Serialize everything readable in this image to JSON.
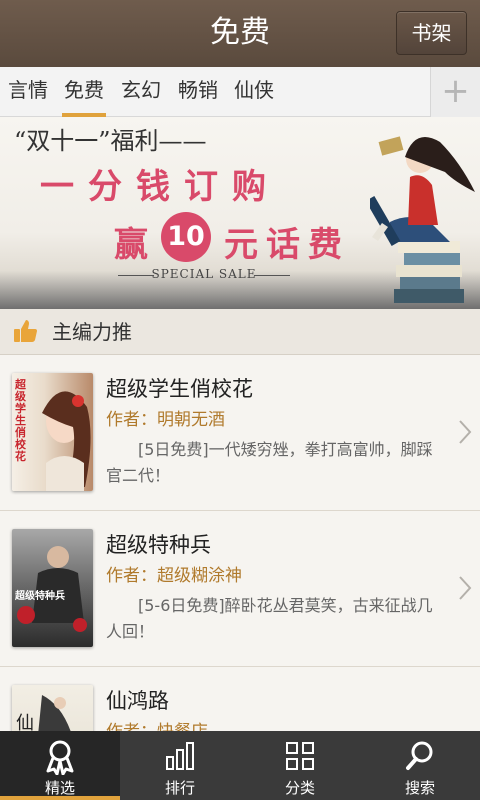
{
  "header": {
    "title": "免费",
    "shelf_button": "书架"
  },
  "tabs": [
    {
      "label": "言情",
      "active": false
    },
    {
      "label": "免费",
      "active": true
    },
    {
      "label": "玄幻",
      "active": false
    },
    {
      "label": "畅销",
      "active": false
    },
    {
      "label": "仙侠",
      "active": false
    }
  ],
  "tab_add_icon": "plus-icon",
  "banner": {
    "line1": "“双十一”福利——",
    "line2": "一分钱订购",
    "line3_prefix": "赢",
    "line3_number": "10",
    "line3_suffix": "元话费",
    "tag": "SPECIAL SALE"
  },
  "section": {
    "title": "主编力推",
    "icon": "thumbs-up-icon"
  },
  "books": [
    {
      "title": "超级学生俏校花",
      "author": "作者：明朝无酒",
      "desc": "[5日免费]一代矮穷矬，拳打高富帅，脚踩官二代！",
      "cover_text": "超级学生俏校花"
    },
    {
      "title": "超级特种兵",
      "author": "作者：超级糊涂神",
      "desc": "[5-6日免费]醉卧花丛君莫笑，古来征战几人回！",
      "cover_text": "超级特种兵"
    },
    {
      "title": "仙鸿路",
      "author": "作者：快餐店",
      "desc": "",
      "cover_text": "仙"
    }
  ],
  "bottom_nav": [
    {
      "label": "精选",
      "icon": "award-icon",
      "active": true
    },
    {
      "label": "排行",
      "icon": "bar-chart-icon",
      "active": false
    },
    {
      "label": "分类",
      "icon": "grid-icon",
      "active": false
    },
    {
      "label": "搜索",
      "icon": "search-icon",
      "active": false
    }
  ],
  "colors": {
    "accent": "#e0a23c",
    "titlebar": "#5f4e41",
    "author": "#b07a2c",
    "banner_text": "#d94a6a"
  }
}
